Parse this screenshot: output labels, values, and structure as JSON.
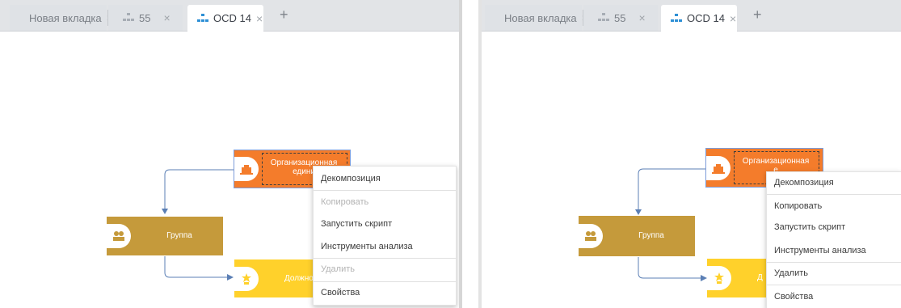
{
  "tabs": [
    {
      "label": "Новая вкладка",
      "close": "×"
    },
    {
      "label": "55",
      "close": "×"
    },
    {
      "label": "OCD 14",
      "close": "×"
    }
  ],
  "new_tab": "+",
  "nodes": {
    "org_line1": "Организационная",
    "org_line2": "единица",
    "org_line2_left_clipped": "едини",
    "org_line2_right_clipped": "е",
    "group": "Группа",
    "position_left_clipped": "Должно",
    "position_right_clipped": "Д"
  },
  "context_menu": {
    "items": [
      {
        "label": "Декомпозиция"
      },
      {
        "label": "Копировать"
      },
      {
        "label": "Запустить скрипт"
      },
      {
        "label": "Инструменты анализа"
      },
      {
        "label": "Удалить"
      },
      {
        "label": "Свойства"
      }
    ]
  },
  "colors": {
    "org": "#f47c2b",
    "group": "#c59a3b",
    "position": "#ffd12b",
    "link": "#5b7fb5"
  }
}
